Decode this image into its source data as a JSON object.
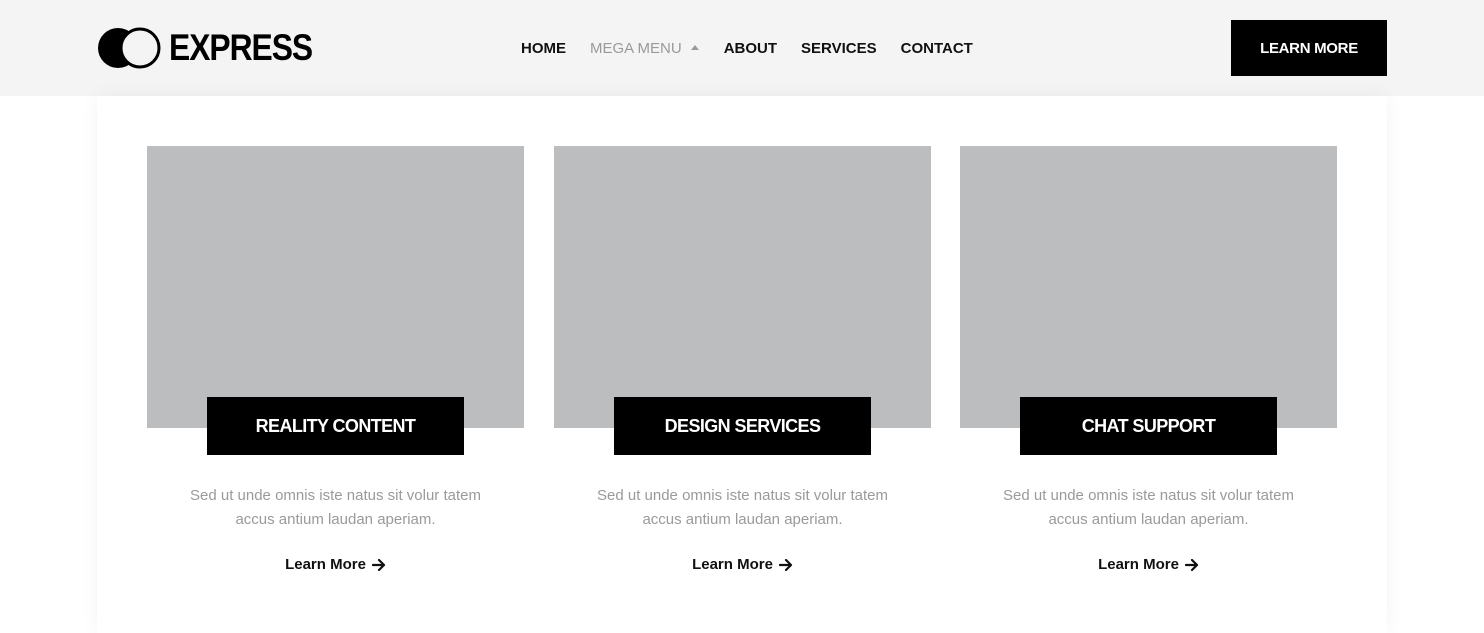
{
  "header": {
    "logo_text": "EXPRESS",
    "nav": [
      {
        "label": "HOME"
      },
      {
        "label": "MEGA MENU"
      },
      {
        "label": "ABOUT"
      },
      {
        "label": "SERVICES"
      },
      {
        "label": "CONTACT"
      }
    ],
    "cta_label": "LEARN MORE"
  },
  "cards": [
    {
      "title": "REALITY CONTENT",
      "text": "Sed ut unde omnis iste natus sit volur tatem accus antium laudan aperiam.",
      "link_label": "Learn More"
    },
    {
      "title": "DESIGN SERVICES",
      "text": "Sed ut unde omnis iste natus sit volur tatem accus antium laudan aperiam.",
      "link_label": "Learn More"
    },
    {
      "title": "CHAT SUPPORT",
      "text": "Sed ut unde omnis iste natus sit volur tatem accus antium laudan aperiam.",
      "link_label": "Learn More"
    }
  ],
  "icons": {
    "logo": "overlapping-circles-logo-icon",
    "dropdown": "caret-up-icon",
    "link_arrow": "arrow-right-icon"
  },
  "colors": {
    "header_bg": "#f4f4f4",
    "accent": "#000000",
    "placeholder": "#bcbdbf",
    "muted_text": "#9a9a9a"
  }
}
